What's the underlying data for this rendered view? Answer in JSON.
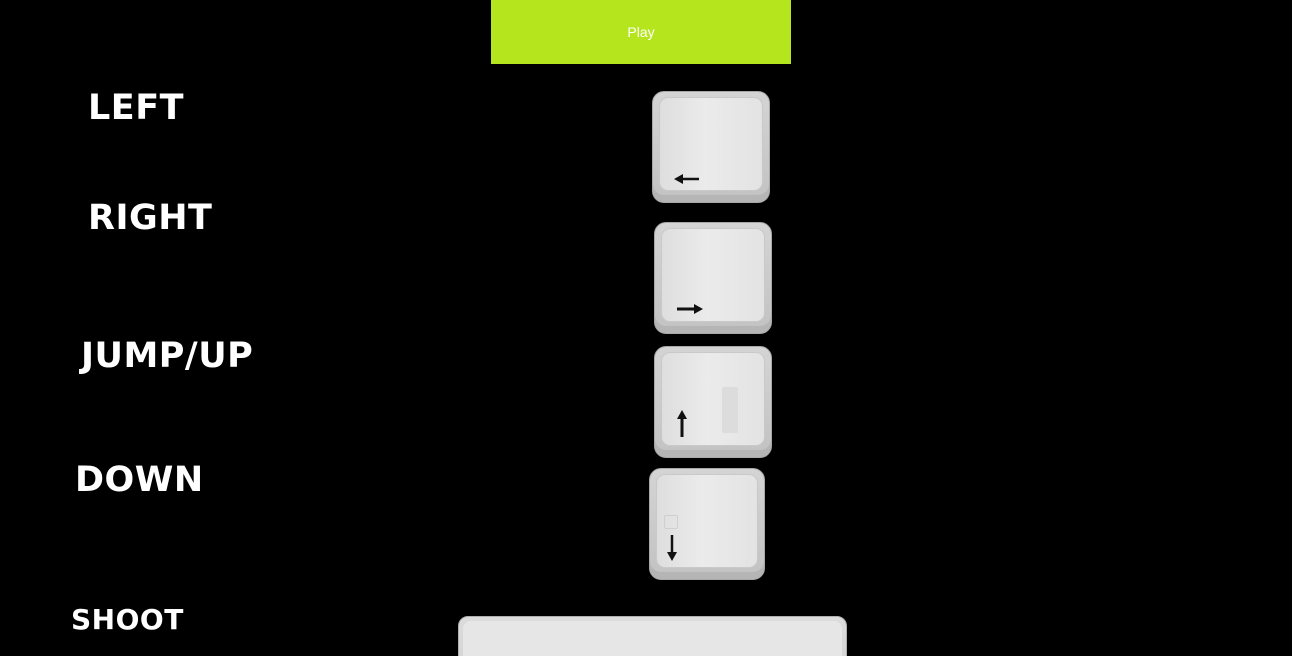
{
  "play_button": {
    "label": "Play",
    "color": "#b5e61d"
  },
  "controls": {
    "left": {
      "label": "LEFT",
      "key_icon": "arrow-left-icon"
    },
    "right": {
      "label": "RIGHT",
      "key_icon": "arrow-right-icon"
    },
    "up": {
      "label": "JUMP/UP",
      "key_icon": "arrow-up-icon"
    },
    "down": {
      "label": "DOWN",
      "key_icon": "arrow-down-icon"
    },
    "shoot": {
      "label": "SHOOT",
      "key_icon": "spacebar-key"
    }
  },
  "colors": {
    "background": "#000000",
    "text": "#ffffff",
    "key": "#d9d9d9"
  }
}
